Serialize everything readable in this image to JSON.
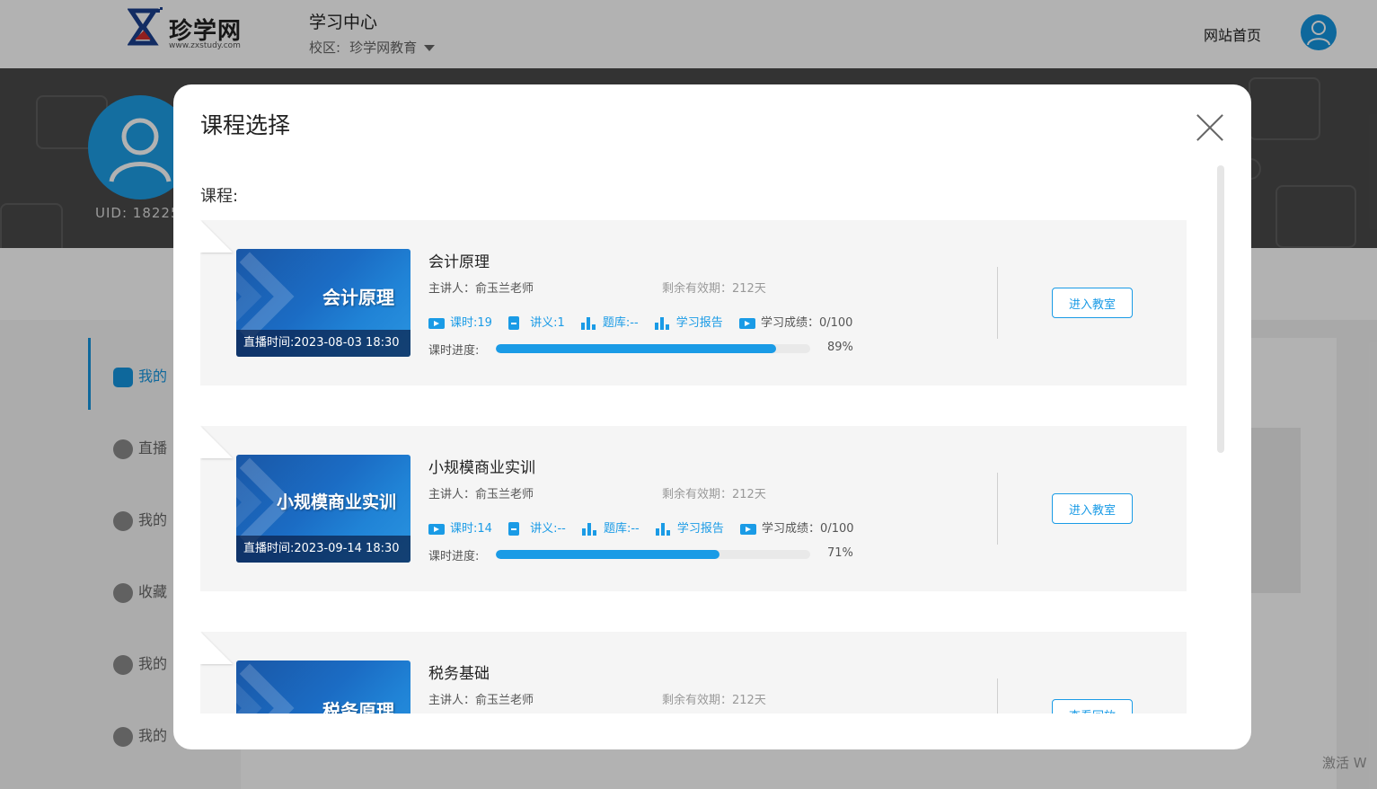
{
  "header": {
    "logo_text": "珍学网",
    "logo_sub": "www.zxstudy.com",
    "center_title": "学习中心",
    "campus_label": "校区:",
    "campus_name": "珍学网教育",
    "home_link": "网站首页"
  },
  "profile": {
    "uid": "UID: 18225"
  },
  "sidebar": {
    "items": [
      {
        "label": "我的",
        "icon": "book-icon",
        "active": true
      },
      {
        "label": "直播",
        "icon": "live-icon"
      },
      {
        "label": "我的",
        "icon": "video-icon"
      },
      {
        "label": "收藏",
        "icon": "star-icon"
      },
      {
        "label": "我的",
        "icon": "graduation-cap-icon"
      },
      {
        "label": "我的",
        "icon": "list-icon"
      }
    ]
  },
  "watermark": "激活 W",
  "modal": {
    "title": "课程选择",
    "course_label": "课程:",
    "courses": [
      {
        "title": "会计原理",
        "thumb_name": "会计原理",
        "live_time": "直播时间:2023-08-03 18:30",
        "teacher": "主讲人：俞玉兰老师",
        "validity": "剩余有效期：212天",
        "lessons": "课时:19",
        "handouts": "讲义:1",
        "question_bank": "题库:--",
        "report": "学习报告",
        "score": "学习成绩：0/100",
        "progress_label": "课时进度:",
        "progress": 89,
        "progress_text": "89%",
        "button": "进入教室"
      },
      {
        "title": "小规模商业实训",
        "thumb_name": "小规模商业实训",
        "live_time": "直播时间:2023-09-14 18:30",
        "teacher": "主讲人：俞玉兰老师",
        "validity": "剩余有效期：212天",
        "lessons": "课时:14",
        "handouts": "讲义:--",
        "question_bank": "题库:--",
        "report": "学习报告",
        "score": "学习成绩：0/100",
        "progress_label": "课时进度:",
        "progress": 71,
        "progress_text": "71%",
        "button": "进入教室"
      },
      {
        "title": "税务基础",
        "thumb_name": "税务原理",
        "teacher": "主讲人：俞玉兰老师",
        "validity": "剩余有效期：212天",
        "button": "查看回放"
      }
    ]
  },
  "colors": {
    "accent": "#1a9be6",
    "banner": "#4a4a4a"
  }
}
